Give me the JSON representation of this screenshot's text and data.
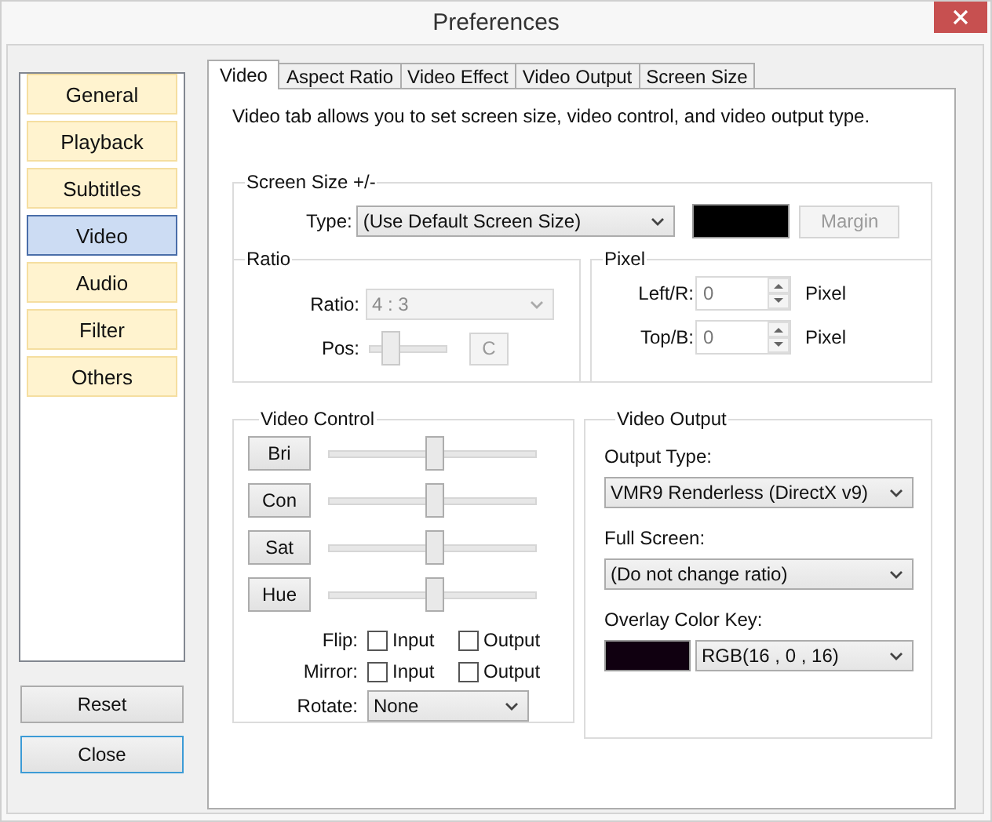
{
  "window": {
    "title": "Preferences"
  },
  "sidebar": {
    "items": [
      {
        "label": "General",
        "selected": false
      },
      {
        "label": "Playback",
        "selected": false
      },
      {
        "label": "Subtitles",
        "selected": false
      },
      {
        "label": "Video",
        "selected": true
      },
      {
        "label": "Audio",
        "selected": false
      },
      {
        "label": "Filter",
        "selected": false
      },
      {
        "label": "Others",
        "selected": false
      }
    ]
  },
  "bottom_buttons": [
    {
      "label": "Reset",
      "default": false
    },
    {
      "label": "Close",
      "default": true
    }
  ],
  "tabs": [
    {
      "label": "Video",
      "selected": true
    },
    {
      "label": "Aspect Ratio",
      "selected": false
    },
    {
      "label": "Video Effect",
      "selected": false
    },
    {
      "label": "Video Output",
      "selected": false
    },
    {
      "label": "Screen Size",
      "selected": false
    }
  ],
  "description": "Video tab allows you to set screen size, video control, and video output type.",
  "screen_size": {
    "title": "Screen Size +/-",
    "type_label": "Type:",
    "type_value": "(Use Default Screen Size)",
    "margin_button": {
      "label": "Margin",
      "disabled": true
    }
  },
  "ratio": {
    "title": "Ratio",
    "ratio_label": "Ratio:",
    "ratio_value": "4 : 3",
    "ratio_disabled": true,
    "pos_label": "Pos:",
    "pos_slider": {
      "level": 0.2,
      "disabled": true
    },
    "center_button": {
      "label": "C",
      "disabled": true
    }
  },
  "pixel": {
    "title": "Pixel",
    "rows": [
      {
        "label": "Left/R:",
        "value": "0",
        "unit": "Pixel"
      },
      {
        "label": "Top/B:",
        "value": "0",
        "unit": "Pixel"
      }
    ]
  },
  "video_control": {
    "title": "Video Control",
    "sliders": [
      {
        "label": "Bri",
        "level": 0.5
      },
      {
        "label": "Con",
        "level": 0.5
      },
      {
        "label": "Sat",
        "level": 0.5
      },
      {
        "label": "Hue",
        "level": 0.5
      }
    ],
    "checks": [
      {
        "label": "Flip:",
        "options": [
          {
            "label": "Input",
            "checked": false
          },
          {
            "label": "Output",
            "checked": false
          }
        ]
      },
      {
        "label": "Mirror:",
        "options": [
          {
            "label": "Input",
            "checked": false
          },
          {
            "label": "Output",
            "checked": false
          }
        ]
      }
    ],
    "rotate_label": "Rotate:",
    "rotate_value": "None"
  },
  "video_output": {
    "title": "Video Output",
    "output_type_label": "Output Type:",
    "output_type_value": "VMR9 Renderless (DirectX v9)",
    "full_screen_label": "Full Screen:",
    "full_screen_value": "(Do not change ratio)",
    "overlay_label": "Overlay Color Key:",
    "overlay_value": "RGB(16 , 0 , 16)"
  }
}
